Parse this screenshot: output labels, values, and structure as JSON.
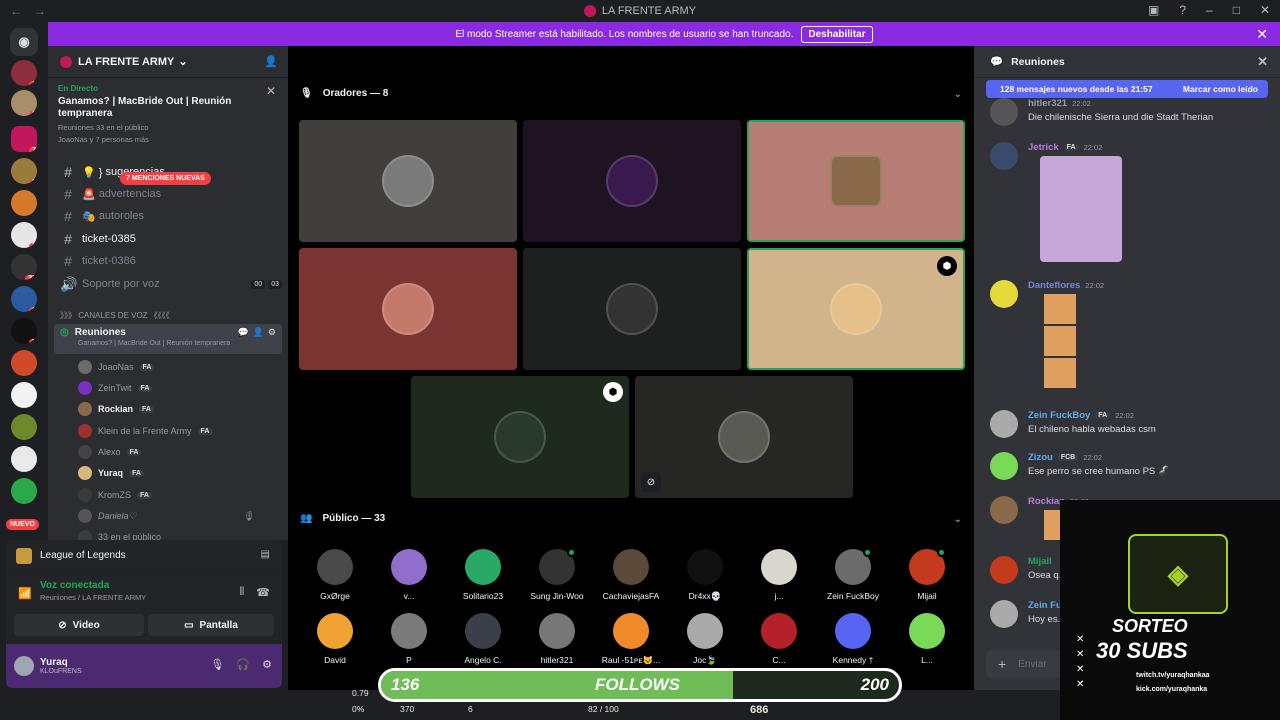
{
  "window": {
    "title": "LA FRENTE ARMY"
  },
  "banner": {
    "text": "El modo Streamer está habilitado. Los nombres de usuario se han truncado.",
    "button": "Deshabilitar"
  },
  "guilds": {
    "badges": [
      "1",
      "2",
      "7",
      "2",
      "2",
      "33",
      "2",
      "7"
    ],
    "nuevo": "NUEVO"
  },
  "server": {
    "name": "LA FRENTE ARMY"
  },
  "event": {
    "status": "En Directo",
    "title": "Ganamos? | MacBride Out | Reunión tempranera",
    "meta": "Reuniones   33 en el público",
    "users": "JoaoNas y 7 personas más"
  },
  "channels": [
    {
      "name": "sugerencias",
      "prefix": "💡 }"
    },
    {
      "name": "advertencias",
      "prefix": "🚨"
    },
    {
      "name": "autoroles",
      "prefix": "🎭"
    },
    {
      "name": "ticket-0385",
      "prefix": ""
    },
    {
      "name": "ticket-0386",
      "prefix": ""
    },
    {
      "name": "Soporte por voz",
      "prefix": "",
      "c1": "00",
      "c2": "03"
    }
  ],
  "mentions": "7 MENCIONES NUEVAS",
  "voice_category": "》》》 CANALES DE VOZ 《《《《",
  "voice_channel": {
    "name": "Reuniones",
    "sub": "Ganamos? | MacBride Out | Reunión tempranera"
  },
  "voice_users": [
    {
      "name": "JoaoNas",
      "tag": "FA"
    },
    {
      "name": "ZeinTwit",
      "tag": "FA"
    },
    {
      "name": "Rockian",
      "tag": "FA"
    },
    {
      "name": "Klein de la Frente Army",
      "tag": "FA"
    },
    {
      "name": "Alexo",
      "tag": "FA"
    },
    {
      "name": "Yuraq",
      "tag": "FA"
    },
    {
      "name": "KromZS",
      "tag": "FA"
    },
    {
      "name": "Daniela♡",
      "tag": ""
    },
    {
      "name": "33 en el público",
      "tag": ""
    }
  ],
  "panel": {
    "game": "League of Legends",
    "voice_status": "Voz conectada",
    "voice_location": "Reuniones / LA FRENTE ARMY",
    "video": "Video",
    "screen": "Pantalla",
    "username": "Yuraq",
    "userstatus": "KLOuFRENS"
  },
  "stage": {
    "speakers_label": "Oradores — 8",
    "audience_label": "Público — 33"
  },
  "audience": [
    {
      "name": "GxØrge",
      "color": "#4a4a4a",
      "online": false
    },
    {
      "name": "v...",
      "color": "#8f6fc9",
      "online": false
    },
    {
      "name": "Solitario23",
      "color": "#29a867",
      "online": false
    },
    {
      "name": "Sung Jin-Woo",
      "color": "#333",
      "online": true
    },
    {
      "name": "CachaviejasFA",
      "color": "#5a4a3a",
      "online": false
    },
    {
      "name": "Dr4xx💀",
      "color": "#111",
      "online": false
    },
    {
      "name": "j...",
      "color": "#d8d6cf",
      "online": false
    },
    {
      "name": "Zein FuckBoy",
      "color": "#6b6b6b",
      "online": true
    },
    {
      "name": "Mijail",
      "color": "#c43a1c",
      "online": true
    },
    {
      "name": "David",
      "color": "#f0a232",
      "online": false
    },
    {
      "name": "P",
      "color": "#7a7a7a",
      "online": false
    },
    {
      "name": "Angelo C.",
      "color": "#3b3f4a",
      "online": false
    },
    {
      "name": "hitler321",
      "color": "#777",
      "online": false
    },
    {
      "name": "Raul -51ᴘᴇ😺...",
      "color": "#f08a2a",
      "online": false
    },
    {
      "name": "Joc🍃",
      "color": "#aaa",
      "online": false
    },
    {
      "name": "C...",
      "color": "#b5202d",
      "online": false
    },
    {
      "name": "Kennedy †",
      "color": "#5865f2",
      "online": false
    },
    {
      "name": "L...",
      "color": "#7ad957",
      "online": false
    }
  ],
  "chat": {
    "channel": "Reuniones",
    "new_messages": "128 mensajes nuevos desde las 21:57",
    "mark_read": "Marcar como leído",
    "input_placeholder": "Enviar",
    "messages": [
      {
        "author": "hitler321",
        "color": "#949ba4",
        "tag": "",
        "time": "22:02",
        "text": "Die chilenische Sierra und die Stadt Therian"
      },
      {
        "author": "Jetrick",
        "color": "#b57edc",
        "tag": "FA",
        "time": "22:02",
        "text": ""
      },
      {
        "author": "Danteflores",
        "color": "#7289da",
        "tag": "",
        "time": "22:02",
        "text": ""
      },
      {
        "author": "Zein FuckBoy",
        "color": "#5dadec",
        "tag": "FA",
        "time": "22:02",
        "text": "El chileno habla webadas csm"
      },
      {
        "author": "Zizou",
        "color": "#5dadec",
        "tag": "FCB",
        "time": "22:02",
        "text": "Ese perro se cree humano PS 🦨"
      },
      {
        "author": "Rockian",
        "color": "#b57edc",
        "tag": "",
        "time": "22:02",
        "text": ""
      },
      {
        "author": "Mijail",
        "color": "#23a55a",
        "tag": "",
        "time": "",
        "text": "Osea q..."
      },
      {
        "author": "Zein Fu...",
        "color": "#5dadec",
        "tag": "",
        "time": "",
        "text": "Hoy es..."
      }
    ]
  },
  "overlay": {
    "follows_current": "136",
    "follows_label": "FOLLOWS",
    "follows_goal": "200",
    "follows_fraction": 0.68,
    "hud": {
      "stat1": "0.79",
      "stat2": "0%",
      "gold": "370",
      "hp": "82 / 100",
      "coins": "686",
      "level": "6"
    }
  },
  "promo": {
    "title1": "SORTEO",
    "title2": "30 SUBS",
    "link1": "twitch.tv/yuraqhankaa",
    "link2": "kick.com/yuraqhanka"
  }
}
